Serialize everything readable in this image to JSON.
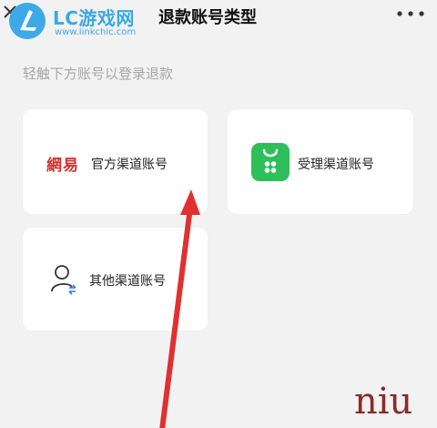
{
  "header": {
    "logo_text": "LC游戏网",
    "logo_url": "www.linkchic.com",
    "title": "退款账号类型"
  },
  "subtitle": "轻触下方账号以登录退款",
  "options": [
    {
      "brand": "網易",
      "label": "官方渠道账号"
    },
    {
      "label": "受理渠道账号"
    },
    {
      "label": "其他渠道账号"
    }
  ],
  "watermark": "niu",
  "colors": {
    "logo_blue": "#3fa9e8",
    "brand_red": "#d2322d",
    "app_green": "#2fbf5a",
    "arrow_red": "#e03030"
  }
}
